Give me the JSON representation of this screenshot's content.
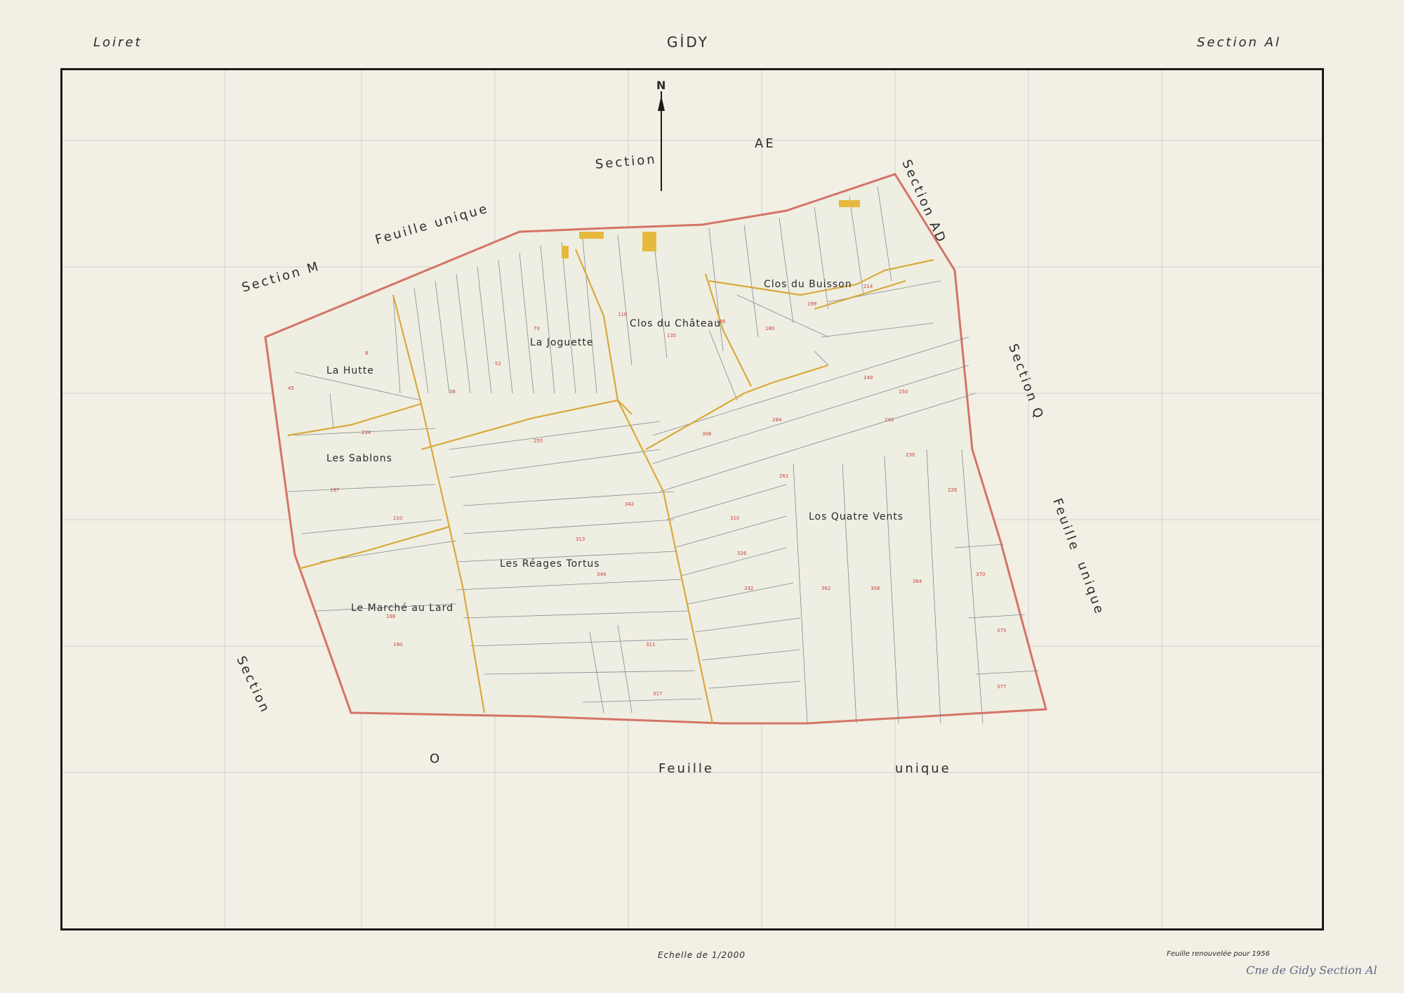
{
  "header": {
    "dept": "Loiret",
    "commune": "GİDY",
    "section": "Section Al"
  },
  "north": "N",
  "neighbors": {
    "ae_word": "Section",
    "ae_letters": "AE",
    "m": "Section M",
    "m_sheet": "Feuille unique",
    "ad": "Section AD",
    "q": "Section Q",
    "q_sheet1": "Feuille",
    "q_sheet2": "unique",
    "o_word": "Section",
    "o_letter": "O",
    "o_sheet1": "Feuille",
    "o_sheet2": "unique"
  },
  "places": {
    "hutte": "La Hutte",
    "joguette": "La Joguette",
    "chateau": "Clos du Château",
    "buisson": "Clos du Buisson",
    "sablons": "Les Sablons",
    "quatre_vents": "Los Quatre Vents",
    "reages": "Les Réages Tortus",
    "marche": "Le Marché au Lard"
  },
  "footer": {
    "scale": "Echelle de 1/2000",
    "note": "Feuille renouvelée pour 1956",
    "signature": "Cne de Gidy Section Al"
  },
  "colors": {
    "boundary": "#d47466",
    "lieu_dit": "#d9a93a",
    "ink": "#2a2a2a",
    "parcel": "#6f7f88"
  }
}
